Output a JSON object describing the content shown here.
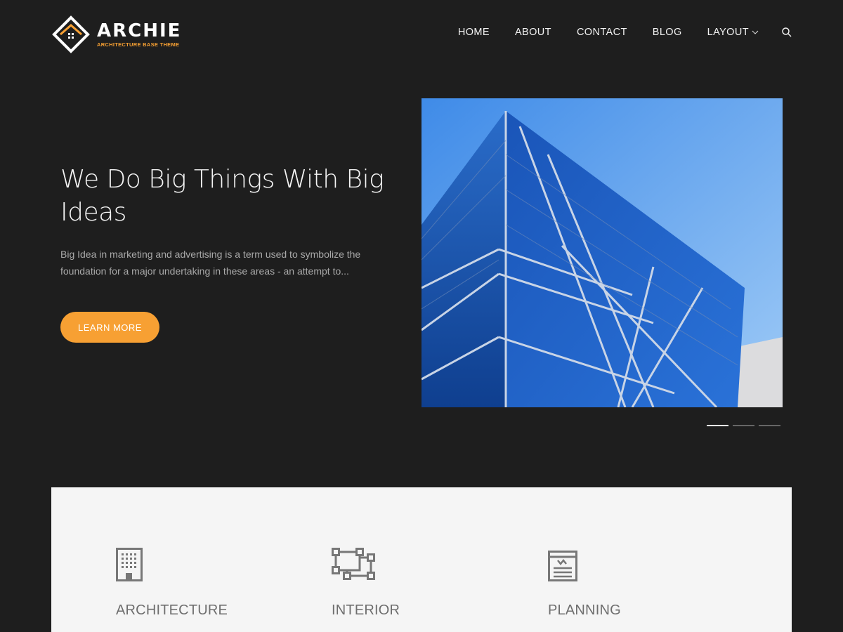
{
  "brand": {
    "name": "ARCHIE",
    "tagline": "ARCHITECTURE BASE THEME",
    "accent_color": "#f7a033"
  },
  "nav": {
    "items": [
      {
        "label": "HOME"
      },
      {
        "label": "ABOUT"
      },
      {
        "label": "CONTACT"
      },
      {
        "label": "BLOG"
      },
      {
        "label": "LAYOUT",
        "has_dropdown": true,
        "icon": "chevron-down-icon"
      }
    ],
    "search_icon": "search-icon"
  },
  "hero": {
    "title": "We Do Big Things With Big Ideas",
    "description": "Big Idea in marketing and advertising is a term used to symbolize the foundation for a major undertaking in these areas - an attempt to...",
    "button_label": "LEARN MORE",
    "slides_count": 3,
    "active_slide": 1
  },
  "services": [
    {
      "label": "ARCHITECTURE",
      "icon": "building-icon"
    },
    {
      "label": "INTERIOR",
      "icon": "floor-plan-icon"
    },
    {
      "label": "PLANNING",
      "icon": "document-plan-icon"
    }
  ]
}
